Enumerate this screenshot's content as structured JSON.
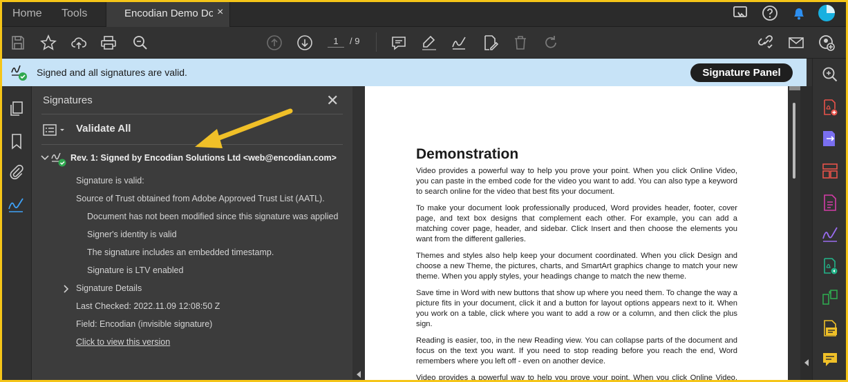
{
  "tabs": {
    "home": "Home",
    "tools": "Tools",
    "document": "Encodian Demo Do...",
    "close": "×"
  },
  "toolbar": {
    "current_page": "1",
    "page_total": "/ 9"
  },
  "signature_bar": {
    "message": "Signed and all signatures are valid.",
    "panel_button": "Signature Panel"
  },
  "signatures_panel": {
    "title": "Signatures",
    "close": "✕",
    "validate_all": "Validate All",
    "revision": "Rev. 1: Signed by Encodian Solutions Ltd <web@encodian.com>",
    "details": [
      "Signature is valid:",
      "Source of Trust obtained from Adobe Approved Trust List (AATL).",
      "Document has not been modified since this signature was applied",
      "Signer's identity is valid",
      "The signature includes an embedded timestamp.",
      "Signature is LTV enabled",
      "Signature Details",
      "Last Checked: 2022.11.09 12:08:50 Z",
      "Field: Encodian (invisible signature)",
      "Click to view this version"
    ]
  },
  "document": {
    "heading": "Demonstration",
    "paragraphs": [
      "Video provides a powerful way to help you prove your point. When you click Online Video, you can paste in the embed code for the video you want to add. You can also type a keyword to search online for the video that best fits your document.",
      "To make your document look professionally produced, Word provides header, footer, cover page, and text box designs that complement each other. For example, you can add a matching cover page, header, and sidebar. Click Insert and then choose the elements you want from the different galleries.",
      "Themes and styles also help keep your document coordinated. When you click Design and choose a new Theme, the pictures, charts, and SmartArt graphics change to match your new theme. When you apply styles, your headings change to match the new theme.",
      "Save time in Word with new buttons that show up where you need them. To change the way a picture fits in your document, click it and a button for layout options appears next to it. When you work on a table, click where you want to add a row or a column, and then click the plus sign.",
      "Reading is easier, too, in the new Reading view. You can collapse parts of the document and focus on the text you want. If you need to stop reading before you reach the end, Word remembers where you left off - even on another device.",
      "Video provides a powerful way to help you prove your point. When you click Online Video, you"
    ]
  },
  "colors": {
    "accent_arrow": "#f0c028",
    "valid_green": "#2fa84f",
    "sig_bar_bg": "#c7e3f7",
    "frame": "#f5c518"
  }
}
